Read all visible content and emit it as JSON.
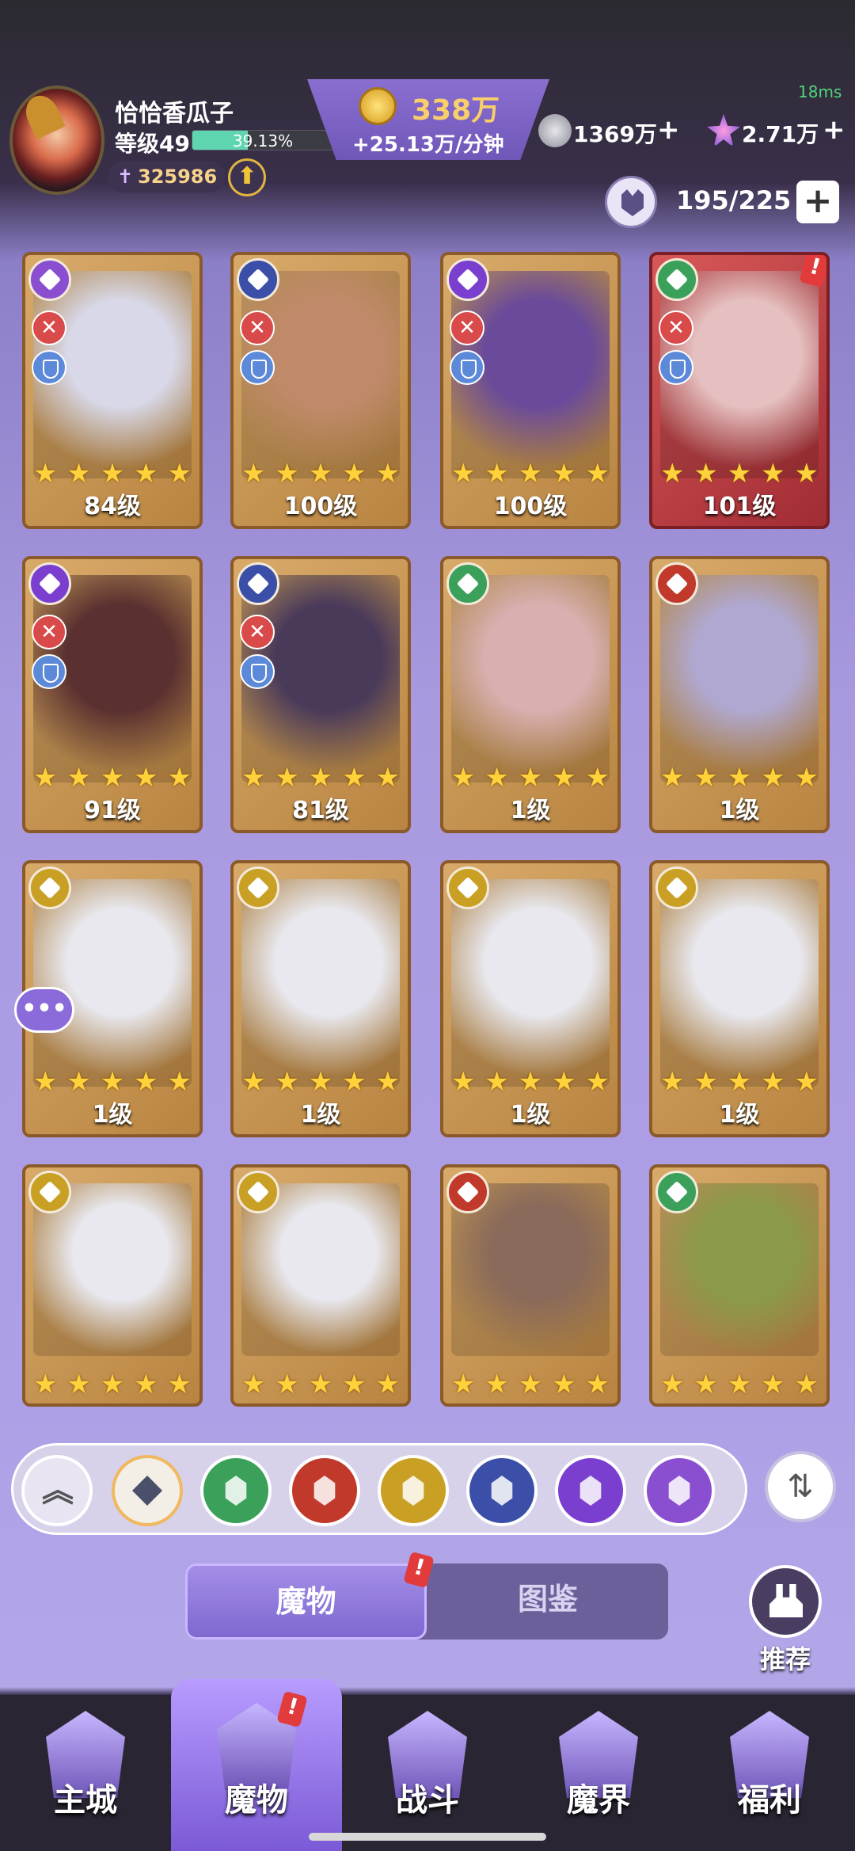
{
  "player": {
    "name": "恰恰香瓜子",
    "level": "等级49",
    "xp_percent": "39.13%",
    "xp_fraction": 0.3913,
    "power": "325986"
  },
  "currency": {
    "gold": "338万",
    "gold_rate": "+25.13万/分钟",
    "silver": "1369万",
    "gems": "2.71万",
    "ping": "18ms"
  },
  "capacity": "195/225",
  "cards": [
    {
      "level": "84级",
      "stars": 5,
      "faction_color": "#8a4fd0",
      "frame": "gold",
      "has_roles": true,
      "art": "#d8d8e8"
    },
    {
      "level": "100级",
      "stars": 5,
      "faction_color": "#3b4fa8",
      "frame": "gold",
      "has_roles": true,
      "art": "#c08a6a"
    },
    {
      "level": "100级",
      "stars": 5,
      "faction_color": "#7b3fd0",
      "frame": "gold",
      "has_roles": true,
      "art": "#6a4a9a"
    },
    {
      "level": "101级",
      "stars": 5,
      "faction_color": "#3aa05a",
      "frame": "red",
      "has_roles": true,
      "art": "#e6c0c0",
      "alert": "!"
    },
    {
      "level": "91级",
      "stars": 5,
      "faction_color": "#7b3fd0",
      "frame": "gold",
      "has_roles": true,
      "art": "#5a3030"
    },
    {
      "level": "81级",
      "stars": 5,
      "faction_color": "#3b4fa8",
      "frame": "gold",
      "has_roles": true,
      "art": "#4a3a5a"
    },
    {
      "level": "1级",
      "stars": 5,
      "faction_color": "#3aa05a",
      "frame": "gold",
      "has_roles": false,
      "art": "#d8b0b0"
    },
    {
      "level": "1级",
      "stars": 5,
      "faction_color": "#c0392b",
      "frame": "gold",
      "has_roles": false,
      "art": "#b0a8d0"
    },
    {
      "level": "1级",
      "stars": 5,
      "faction_color": "#c9a024",
      "frame": "gold",
      "has_roles": false,
      "art": "#e8e8ee"
    },
    {
      "level": "1级",
      "stars": 5,
      "faction_color": "#c9a024",
      "frame": "gold",
      "has_roles": false,
      "art": "#e8e8ee"
    },
    {
      "level": "1级",
      "stars": 5,
      "faction_color": "#c9a024",
      "frame": "gold",
      "has_roles": false,
      "art": "#e8e8ee"
    },
    {
      "level": "1级",
      "stars": 5,
      "faction_color": "#c9a024",
      "frame": "gold",
      "has_roles": false,
      "art": "#e8e8ee"
    },
    {
      "level": "",
      "stars": 5,
      "faction_color": "#c9a024",
      "frame": "gold",
      "has_roles": false,
      "art": "#e8e8ee"
    },
    {
      "level": "",
      "stars": 5,
      "faction_color": "#c9a024",
      "frame": "gold",
      "has_roles": false,
      "art": "#e8e8ee"
    },
    {
      "level": "",
      "stars": 5,
      "faction_color": "#c0392b",
      "frame": "gold",
      "has_roles": false,
      "art": "#8a6a5a"
    },
    {
      "level": "",
      "stars": 5,
      "faction_color": "#3aa05a",
      "frame": "gold",
      "has_roles": false,
      "art": "#8a9a4a"
    }
  ],
  "filters": [
    {
      "name": "collapse",
      "color": "#e8e4f2",
      "icon": "chevrons-up-icon"
    },
    {
      "name": "all",
      "color": "#f3efe6",
      "icon": "diamond-grid-icon"
    },
    {
      "name": "nature",
      "color": "#3aa05a",
      "icon": "leaf-icon"
    },
    {
      "name": "demon",
      "color": "#c0392b",
      "icon": "demon-mask-icon"
    },
    {
      "name": "time",
      "color": "#c9a024",
      "icon": "hourglass-icon"
    },
    {
      "name": "beast",
      "color": "#3b4fa8",
      "icon": "dragon-icon"
    },
    {
      "name": "eye",
      "color": "#7b3fd0",
      "icon": "eye-icon"
    },
    {
      "name": "arcane",
      "color": "#8a4fd0",
      "icon": "rune-icon"
    }
  ],
  "tabs": {
    "monsters": "魔物",
    "codex": "图鉴"
  },
  "recommend": "推荐",
  "nav": [
    {
      "label": "主城",
      "icon": "castle-icon"
    },
    {
      "label": "魔物",
      "icon": "flame-star-icon"
    },
    {
      "label": "战斗",
      "icon": "sword-shield-icon"
    },
    {
      "label": "魔界",
      "icon": "portal-icon"
    },
    {
      "label": "福利",
      "icon": "treasure-chest-icon"
    }
  ],
  "alert_mark": "!"
}
